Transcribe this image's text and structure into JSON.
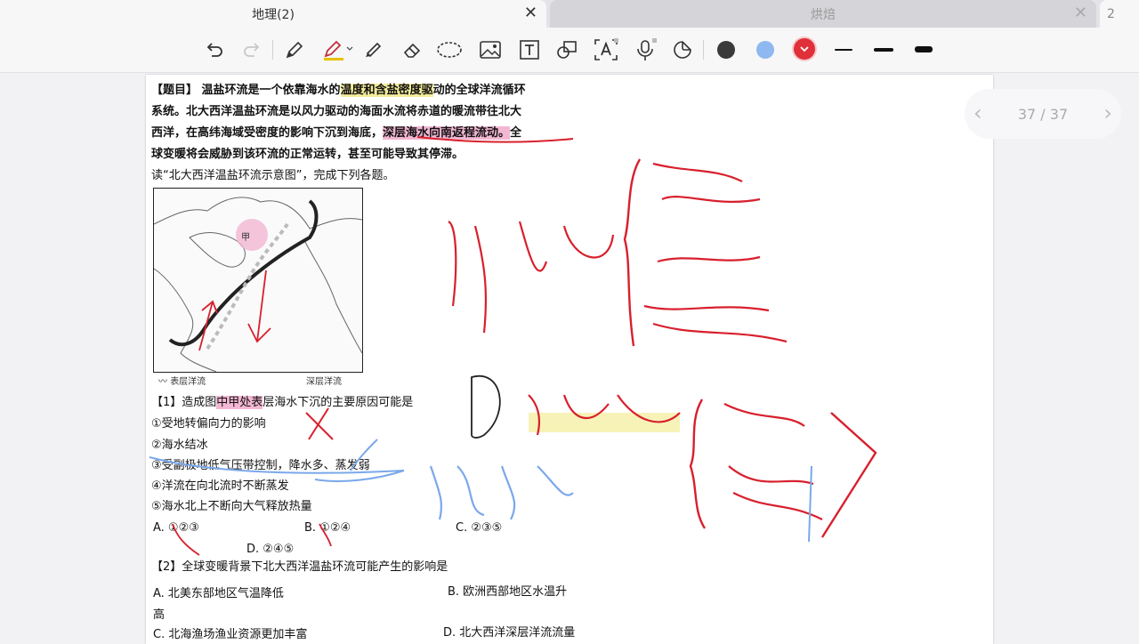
{
  "tabs": [
    {
      "label": "地理(2)",
      "close": "✕"
    },
    {
      "label": "烘焙",
      "close": "✕"
    },
    {
      "label": "2"
    }
  ],
  "toolbar": {
    "tools": [
      "undo-icon",
      "redo-icon",
      "pen-icon",
      "highlighter-icon",
      "marker-icon",
      "eraser-icon",
      "lasso-icon",
      "image-icon",
      "text-icon",
      "shape-icon",
      "ocr-text-icon",
      "microphone-icon",
      "sticker-icon"
    ],
    "colors": [
      "#3a3a3a",
      "#8fb8f0",
      "#e0303a"
    ],
    "selected_color": "#e0303a"
  },
  "pager": {
    "label": "37 / 37",
    "prev": "‹",
    "next": "›"
  },
  "doc": {
    "q_tag": "【题目】",
    "l1a": "温盐环流是一个依靠海水的",
    "l1b": "温度和含盐密度驱",
    "l1c": "动的全球洋流循环",
    "l2": "系统。北大西洋温盐环流是以风力驱动的海面水流将赤道的暖流带往北大",
    "l3a": "西洋，在高纬海域受密度的影响下沉到海底，",
    "l3b": "深层海水向南返程流动。",
    "l3c": "全",
    "l4": "球变暖将会威胁到该环流的正常运转，甚至可能导致其停滞。",
    "l5": "读“北大西洋温盐环流示意图”，完成下列各题。",
    "legend_surface": "表层洋流",
    "legend_deep": "深层洋流",
    "map_label": "甲",
    "q1a": "【1】造成图",
    "q1b": "中甲处表",
    "q1c": "层海水下沉的主要原因可能是",
    "o1": "①受地转偏向力的影响",
    "o2": "②海水结冰",
    "o3": "③受副极地低气压带控制，降水多、蒸发弱",
    "o4": "④洋流在向北流时不断蒸发",
    "o5": "⑤海水北上不断向大气释放热量",
    "a1": "A. ①②③",
    "b1": "B. ①②④",
    "c1": "C. ②③⑤",
    "d1": "D. ②④⑤",
    "q2": "【2】全球变暖背景下北大西洋温盐环流可能产生的影响是",
    "a2": "A. 北美东部地区气温降低",
    "b2": "B. 欧洲西部地区水温升",
    "b2c": "高",
    "c2": "C. 北海渔场渔业资源更加丰富",
    "d2": "D. 北大西洋深层洋流流量"
  }
}
